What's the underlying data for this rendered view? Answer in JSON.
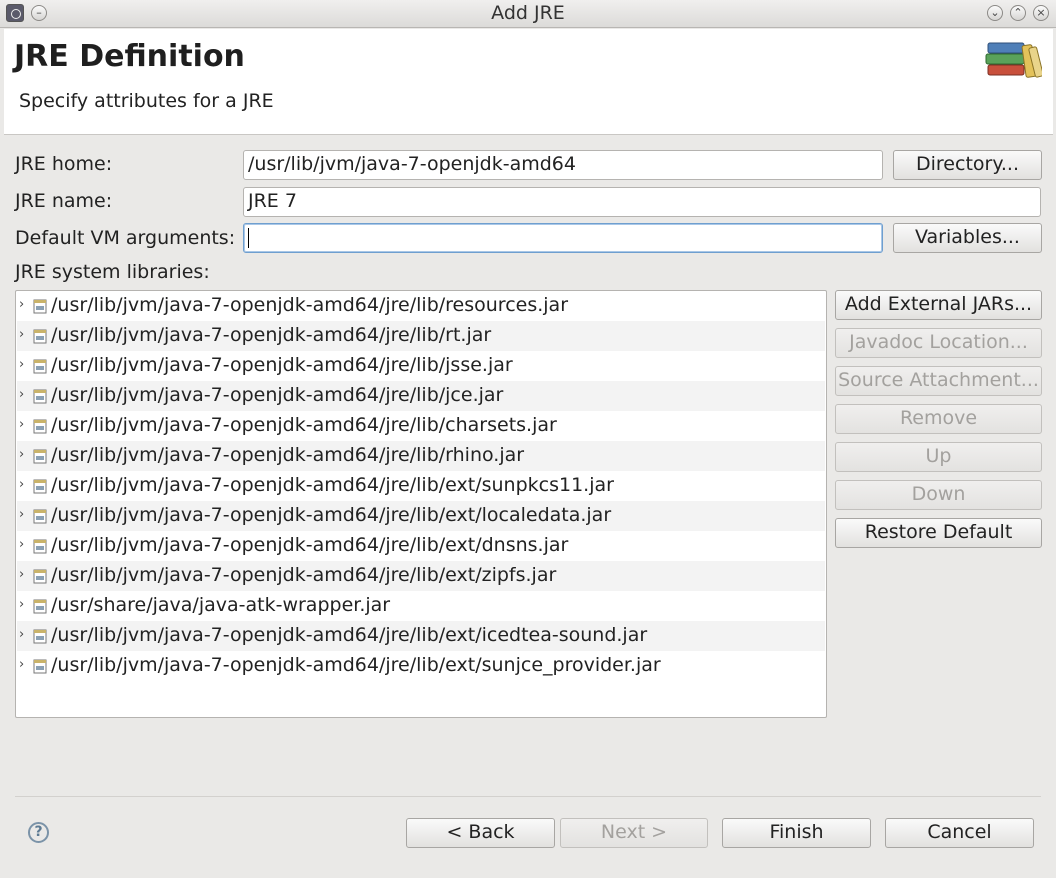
{
  "window": {
    "title": "Add JRE"
  },
  "header": {
    "title": "JRE Definition",
    "subtitle": "Specify attributes for a JRE"
  },
  "form": {
    "jre_home": {
      "label": "JRE home:",
      "value": "/usr/lib/jvm/java-7-openjdk-amd64"
    },
    "jre_name": {
      "label": "JRE name:",
      "value": "JRE 7"
    },
    "vm_args": {
      "label": "Default VM arguments:",
      "value": ""
    },
    "libraries_label": "JRE system libraries:"
  },
  "buttons": {
    "directory": "Directory...",
    "variables": "Variables...",
    "add_external_jars": "Add External JARs...",
    "javadoc_location": "Javadoc Location...",
    "source_attachment": "Source Attachment...",
    "remove": "Remove",
    "up": "Up",
    "down": "Down",
    "restore_default": "Restore Default",
    "back": "< Back",
    "next": "Next >",
    "finish": "Finish",
    "cancel": "Cancel"
  },
  "libraries": [
    "/usr/lib/jvm/java-7-openjdk-amd64/jre/lib/resources.jar",
    "/usr/lib/jvm/java-7-openjdk-amd64/jre/lib/rt.jar",
    "/usr/lib/jvm/java-7-openjdk-amd64/jre/lib/jsse.jar",
    "/usr/lib/jvm/java-7-openjdk-amd64/jre/lib/jce.jar",
    "/usr/lib/jvm/java-7-openjdk-amd64/jre/lib/charsets.jar",
    "/usr/lib/jvm/java-7-openjdk-amd64/jre/lib/rhino.jar",
    "/usr/lib/jvm/java-7-openjdk-amd64/jre/lib/ext/sunpkcs11.jar",
    "/usr/lib/jvm/java-7-openjdk-amd64/jre/lib/ext/localedata.jar",
    "/usr/lib/jvm/java-7-openjdk-amd64/jre/lib/ext/dnsns.jar",
    "/usr/lib/jvm/java-7-openjdk-amd64/jre/lib/ext/zipfs.jar",
    "/usr/share/java/java-atk-wrapper.jar",
    "/usr/lib/jvm/java-7-openjdk-amd64/jre/lib/ext/icedtea-sound.jar",
    "/usr/lib/jvm/java-7-openjdk-amd64/jre/lib/ext/sunjce_provider.jar"
  ],
  "icons": {
    "window": "eclipse-window-icon",
    "minimize": "chevron-down-icon",
    "maximize": "chevron-up-icon",
    "close": "close-icon",
    "header": "books-icon",
    "library": "jar-file-icon",
    "expand": "chevron-right-icon",
    "help": "help-icon"
  }
}
